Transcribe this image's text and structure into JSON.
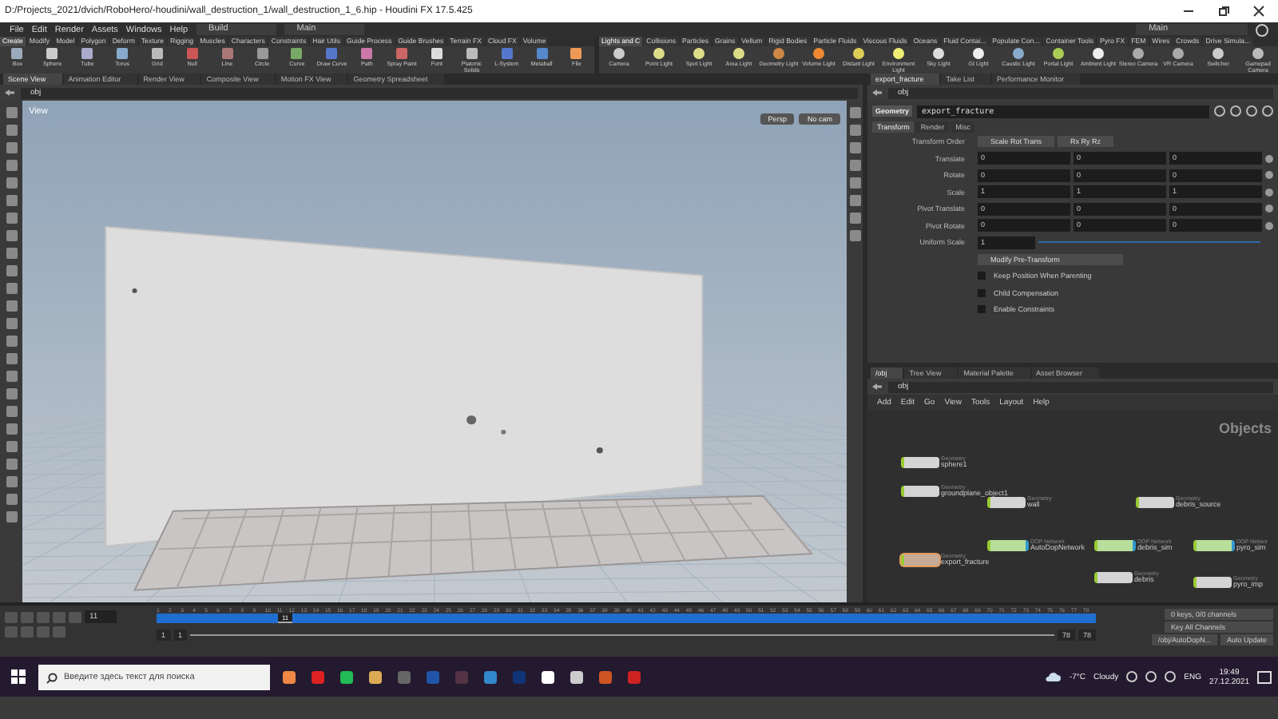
{
  "window": {
    "title": "D:/Projects_2021/dvich/RoboHero/-houdini/wall_destruction_1/wall_destruction_1_6.hip - Houdini FX 17.5.425"
  },
  "menu": [
    "File",
    "Edit",
    "Render",
    "Assets",
    "Windows",
    "Help"
  ],
  "desktop": "Build",
  "left_desktop_main": "Main",
  "right_desktop": "Main",
  "shelf_left": {
    "tabs": [
      {
        "label": "Create",
        "selected": true
      },
      {
        "label": "Modify",
        "selected": false
      },
      {
        "label": "Model",
        "selected": false
      },
      {
        "label": "Polygon",
        "selected": false
      },
      {
        "label": "Deform",
        "selected": false
      },
      {
        "label": "Texture",
        "selected": false
      },
      {
        "label": "Rigging",
        "selected": false
      },
      {
        "label": "Muscles",
        "selected": false
      },
      {
        "label": "Characters",
        "selected": false
      },
      {
        "label": "Constraints",
        "selected": false
      },
      {
        "label": "Hair Utils",
        "selected": false
      },
      {
        "label": "Guide Process",
        "selected": false
      },
      {
        "label": "Guide Brushes",
        "selected": false
      },
      {
        "label": "Terrain FX",
        "selected": false
      },
      {
        "label": "Cloud FX",
        "selected": false
      },
      {
        "label": "Volume",
        "selected": false
      }
    ],
    "tools": [
      "Box",
      "Sphere",
      "Tube",
      "Torus",
      "Grid",
      "Null",
      "Line",
      "Circle",
      "Curve",
      "Draw Curve",
      "Path",
      "Spray Paint",
      "Font",
      "Platonic Solids",
      "L-System",
      "Metaball",
      "File"
    ]
  },
  "shelf_right": {
    "tabs": [
      {
        "label": "Lights and C",
        "selected": true
      },
      {
        "label": "Collisions",
        "selected": false
      },
      {
        "label": "Particles",
        "selected": false
      },
      {
        "label": "Grains",
        "selected": false
      },
      {
        "label": "Vellum",
        "selected": false
      },
      {
        "label": "Rigid Bodies",
        "selected": false
      },
      {
        "label": "Particle Fluids",
        "selected": false
      },
      {
        "label": "Viscous Fluids",
        "selected": false
      },
      {
        "label": "Oceans",
        "selected": false
      },
      {
        "label": "Fluid Contai...",
        "selected": false
      },
      {
        "label": "Populate Con...",
        "selected": false
      },
      {
        "label": "Container Tools",
        "selected": false
      },
      {
        "label": "Pyro FX",
        "selected": false
      },
      {
        "label": "FEM",
        "selected": false
      },
      {
        "label": "Wires",
        "selected": false
      },
      {
        "label": "Crowds",
        "selected": false
      },
      {
        "label": "Drive Simula...",
        "selected": false
      }
    ],
    "tools": [
      "Camera",
      "Point Light",
      "Spot Light",
      "Area Light",
      "Geometry Light",
      "Volume Light",
      "Distant Light",
      "Environment Light",
      "Sky Light",
      "GI Light",
      "Caustic Light",
      "Portal Light",
      "Ambient Light",
      "Stereo Camera",
      "VR Camera",
      "Switcher",
      "Gamepad Camera"
    ]
  },
  "viewer": {
    "tabs": [
      {
        "label": "Scene View",
        "selected": true
      },
      {
        "label": "Animation Editor",
        "selected": false
      },
      {
        "label": "Render View",
        "selected": false
      },
      {
        "label": "Composite View",
        "selected": false
      },
      {
        "label": "Motion FX View",
        "selected": false
      },
      {
        "label": "Geometry Spreadsheet",
        "selected": false
      }
    ],
    "path": "obj",
    "label": "View",
    "projection": "Persp",
    "camera": "No cam"
  },
  "params": {
    "tabs_top": [
      {
        "label": "export_fracture",
        "selected": true
      },
      {
        "label": "Take List",
        "selected": false
      },
      {
        "label": "Performance Monitor",
        "selected": false
      }
    ],
    "path": "obj",
    "node_type": "Geometry",
    "node_name": "export_fracture",
    "tabs": [
      {
        "label": "Transform",
        "selected": true
      },
      {
        "label": "Render",
        "selected": false
      },
      {
        "label": "Misc",
        "selected": false
      }
    ],
    "transform_order": {
      "label": "Transform Order",
      "values": [
        "Scale Rot Trans",
        "Rx Ry Rz"
      ]
    },
    "vectors": [
      {
        "label": "Translate",
        "values": [
          "0",
          "0",
          "0"
        ]
      },
      {
        "label": "Rotate",
        "values": [
          "0",
          "0",
          "0"
        ]
      },
      {
        "label": "Scale",
        "values": [
          "1",
          "1",
          "1"
        ]
      },
      {
        "label": "Pivot Translate",
        "values": [
          "0",
          "0",
          "0"
        ]
      },
      {
        "label": "Pivot Rotate",
        "values": [
          "0",
          "0",
          "0"
        ]
      }
    ],
    "uniform_scale": {
      "label": "Uniform Scale",
      "value": "1",
      "level": 1
    },
    "pre_transform": "Modify Pre-Transform",
    "checkboxes": [
      {
        "label": "Keep Position When Parenting",
        "checked": false
      },
      {
        "label": "Child Compensation",
        "checked": false
      },
      {
        "label": "Enable Constraints",
        "checked": false
      }
    ]
  },
  "network": {
    "tabs": [
      {
        "label": "/obj",
        "selected": true
      },
      {
        "label": "Tree View",
        "selected": false
      },
      {
        "label": "Material Palette",
        "selected": false
      },
      {
        "label": "Asset Browser",
        "selected": false
      }
    ],
    "path": "obj",
    "menu": [
      "Add",
      "Edit",
      "Go",
      "View",
      "Tools",
      "Layout",
      "Help"
    ],
    "context": "Objects",
    "nodes": [
      {
        "kind": "geometry",
        "type": "Geometry",
        "name": "sphere1",
        "selected": false
      },
      {
        "kind": "geometry",
        "type": "Geometry",
        "name": "groundplane_object1",
        "selected": false
      },
      {
        "kind": "geometry",
        "type": "Geometry",
        "name": "wall",
        "selected": false
      },
      {
        "kind": "geometry",
        "type": "Geometry",
        "name": "debris_source",
        "selected": false
      },
      {
        "kind": "dop",
        "type": "DOP Network",
        "name": "AutoDopNetwork",
        "selected": false
      },
      {
        "kind": "dop",
        "type": "DOP Network",
        "name": "debris_sim",
        "selected": false
      },
      {
        "kind": "dop",
        "type": "DOP Networ",
        "name": "pyro_sim",
        "selected": false
      },
      {
        "kind": "geometry",
        "type": "Geometry",
        "name": "export_fracture",
        "selected": true
      },
      {
        "kind": "geometry",
        "type": "Geometry",
        "name": "debris",
        "selected": false
      },
      {
        "kind": "geometry",
        "type": "Geometry",
        "name": "pyro_imp",
        "selected": false
      }
    ]
  },
  "timeline": {
    "frame": "11",
    "playhead": "11",
    "level": 0.13,
    "range": [
      "1",
      "1",
      "78",
      "78"
    ],
    "ruler": [
      "1",
      "2",
      "3",
      "4",
      "5",
      "6",
      "7",
      "8",
      "9",
      "10",
      "11",
      "12",
      "13",
      "14",
      "15",
      "16",
      "17",
      "18",
      "19",
      "20",
      "21",
      "22",
      "23",
      "24",
      "25",
      "26",
      "27",
      "28",
      "29",
      "30",
      "31",
      "32",
      "33",
      "34",
      "35",
      "36",
      "37",
      "38",
      "39",
      "40",
      "41",
      "42",
      "43",
      "44",
      "45",
      "46",
      "47",
      "48",
      "49",
      "50",
      "51",
      "52",
      "53",
      "54",
      "55",
      "56",
      "57",
      "58",
      "59",
      "60",
      "61",
      "62",
      "63",
      "64",
      "65",
      "66",
      "67",
      "68",
      "69",
      "70",
      "71",
      "72",
      "73",
      "74",
      "75",
      "76",
      "77",
      "78"
    ],
    "keys": "0 keys, 0/0 channels",
    "key_all": "Key All Channels",
    "sim_path": "/obj/AutoDopN...",
    "update": "Auto Update"
  },
  "taskbar": {
    "search_placeholder": "Введите здесь текст для поиска",
    "temperature": "-7°C",
    "weather": "Cloudy",
    "language": "ENG",
    "time": "19:49",
    "date": "27.12.2021"
  }
}
